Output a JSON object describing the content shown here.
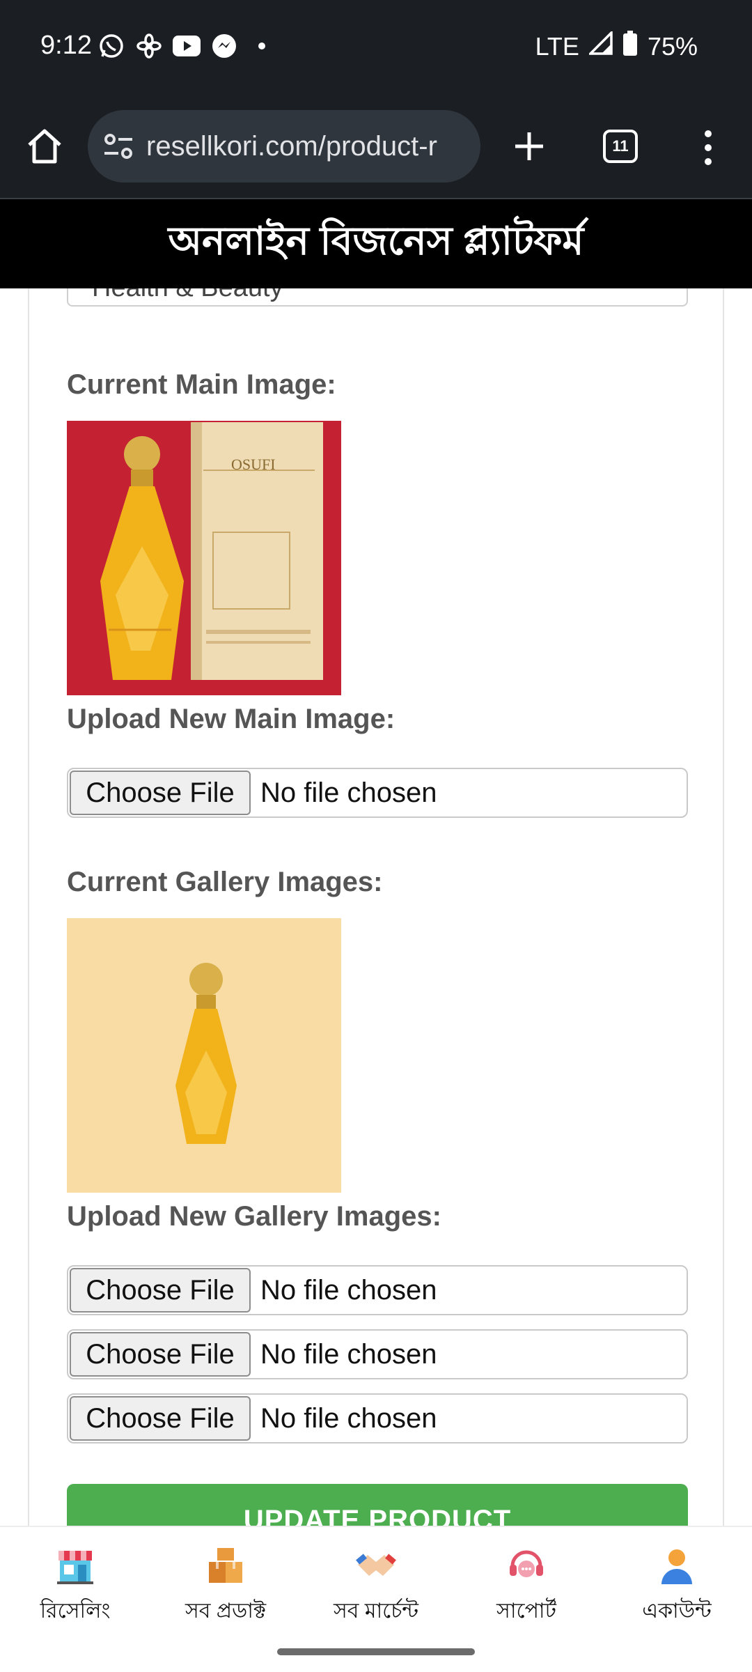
{
  "status_bar": {
    "time": "9:12",
    "network": "LTE",
    "battery": "75%",
    "icons": [
      "whatsapp-icon",
      "pinwheel-icon",
      "youtube-icon",
      "messenger-icon",
      "dot-icon",
      "signal-icon",
      "battery-icon"
    ]
  },
  "browser": {
    "url": "resellkori.com/product-r",
    "tab_count": "11"
  },
  "site_header": {
    "title": "অনলাইন বিজনেস প্ল্যাটফর্ম"
  },
  "form": {
    "category_value": "Health & Beauty",
    "current_main_image_label": "Current Main Image:",
    "main_image_brand": "OSUFI",
    "upload_main_label": "Upload New Main Image:",
    "current_gallery_label": "Current Gallery Images:",
    "upload_gallery_label": "Upload New Gallery Images:",
    "file_inputs": [
      {
        "button": "Choose File",
        "status": "No file chosen"
      },
      {
        "button": "Choose File",
        "status": "No file chosen"
      },
      {
        "button": "Choose File",
        "status": "No file chosen"
      },
      {
        "button": "Choose File",
        "status": "No file chosen"
      }
    ],
    "submit_label": "UPDATE PRODUCT"
  },
  "bottom_nav": [
    {
      "label": "রিসেলিং",
      "icon": "shop-icon"
    },
    {
      "label": "সব প্রডাক্ট",
      "icon": "boxes-icon"
    },
    {
      "label": "সব মার্চেন্ট",
      "icon": "handshake-icon"
    },
    {
      "label": "সাপোর্ট",
      "icon": "support-icon"
    },
    {
      "label": "একাউন্ট",
      "icon": "account-icon"
    }
  ],
  "colors": {
    "status_bg": "#1b1f24",
    "header_bg": "#000000",
    "submit_bg": "#4cae4f",
    "main_image_bg": "#c42133",
    "gallery_image_bg": "#f8dca4"
  }
}
